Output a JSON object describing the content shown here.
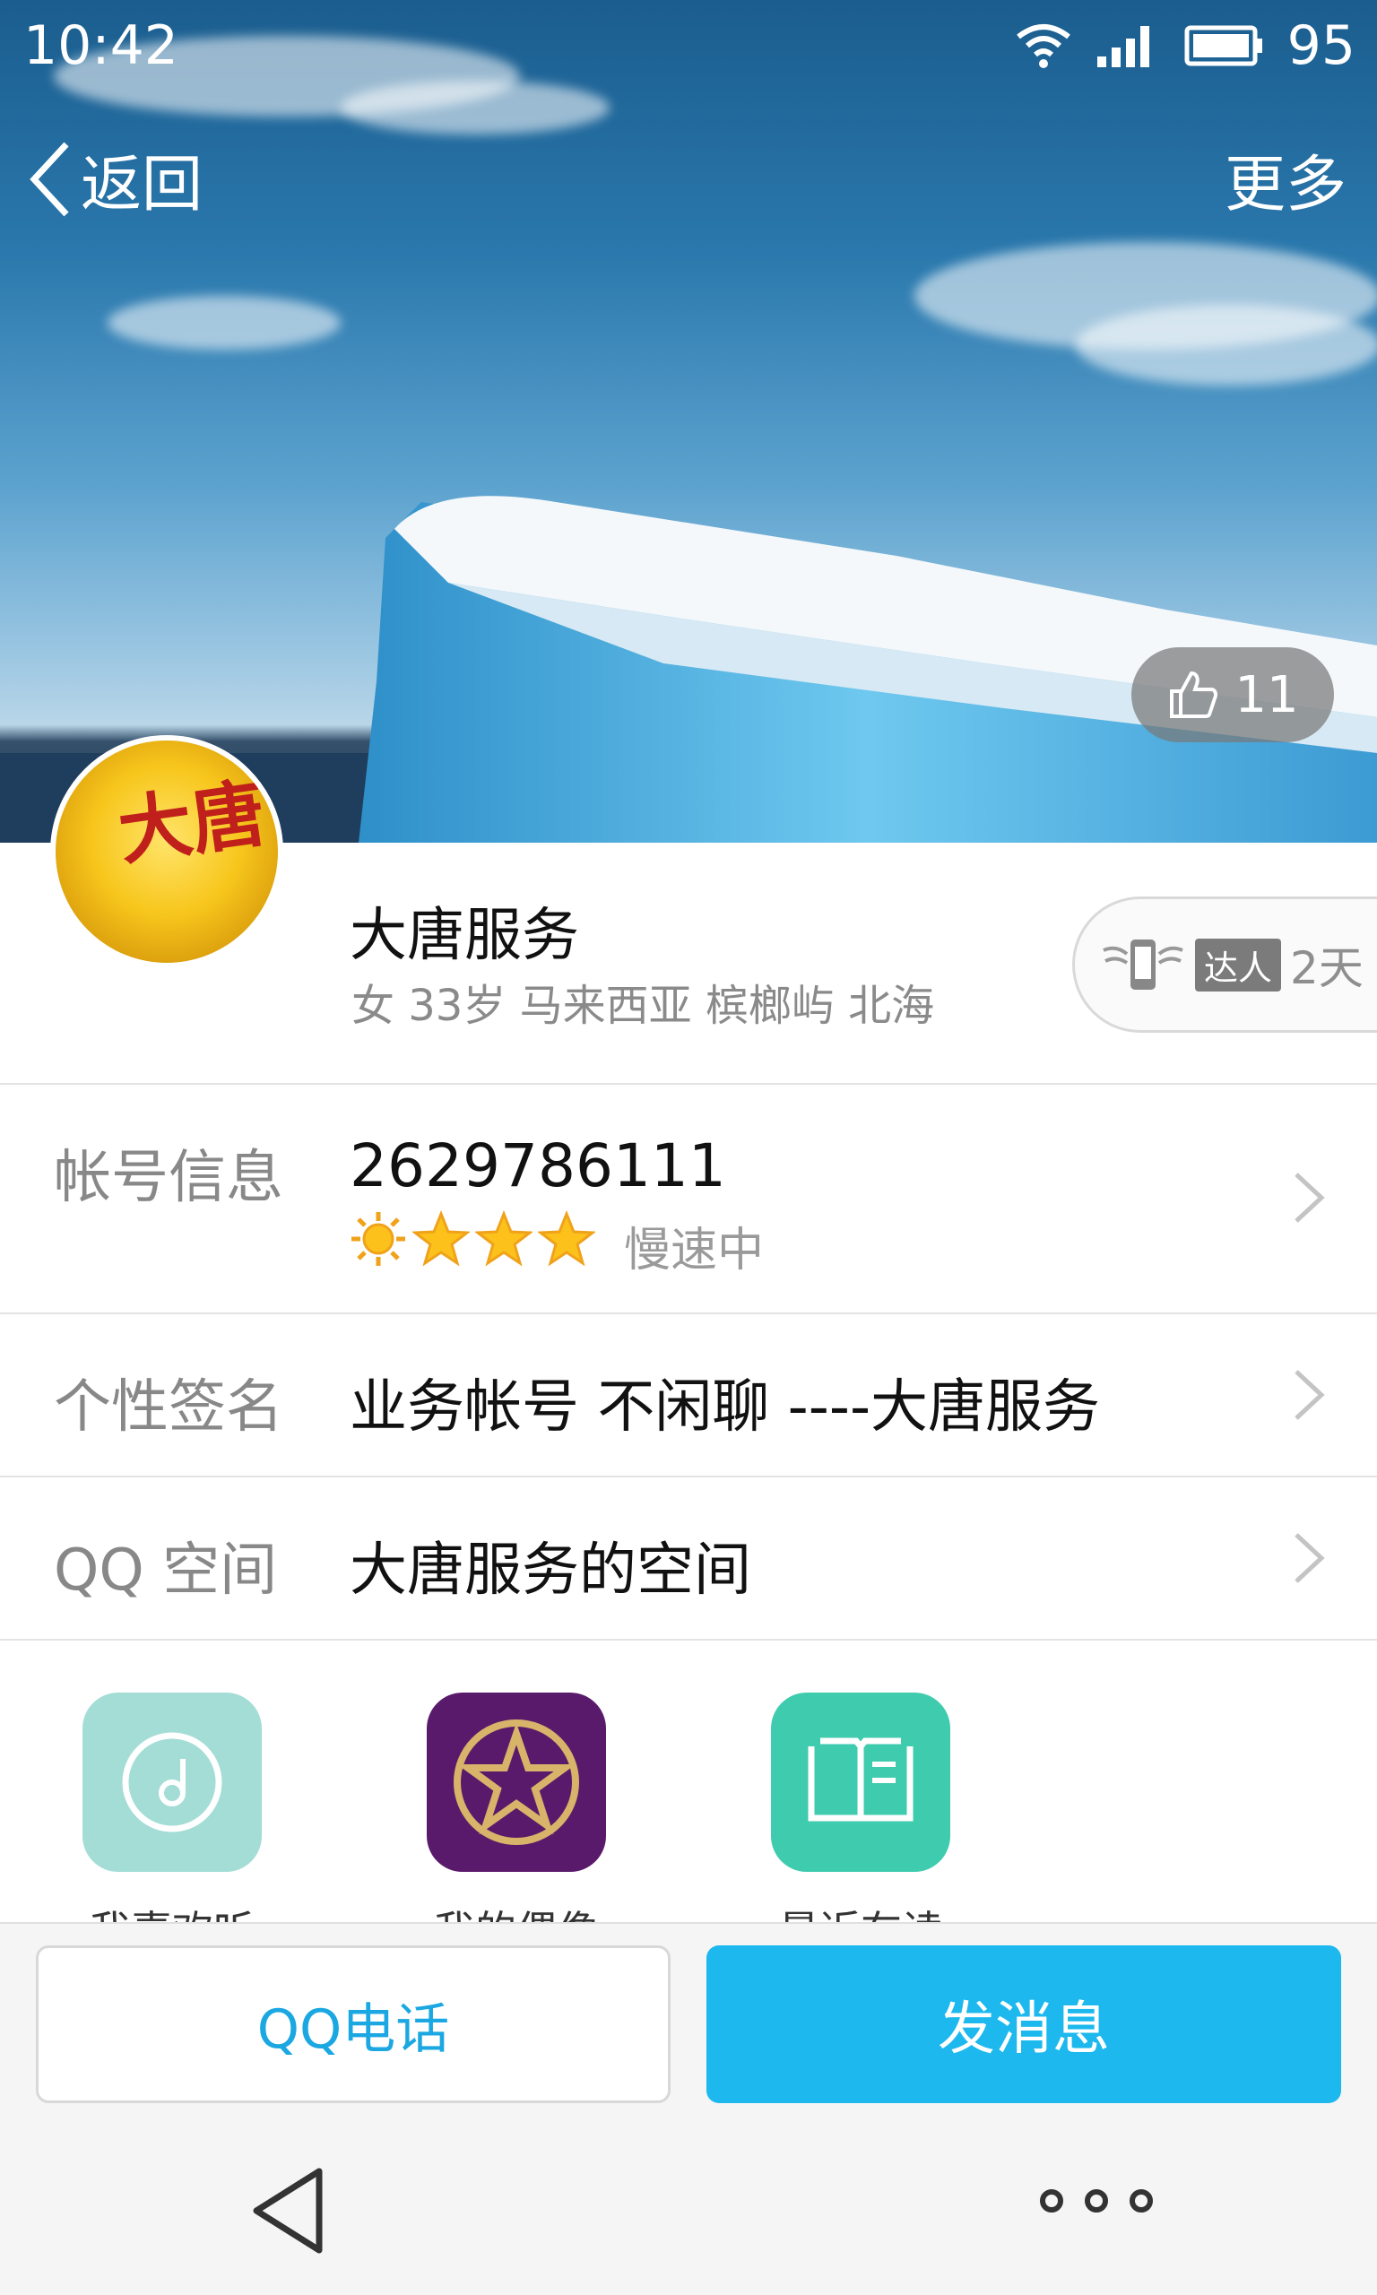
{
  "status_bar": {
    "time": "10:42",
    "battery": "95"
  },
  "nav": {
    "back_label": "返回",
    "more_label": "更多"
  },
  "likes": {
    "count": "11"
  },
  "avatar": {
    "logo_text": "大唐"
  },
  "profile": {
    "name": "大唐服务",
    "meta": "女 33岁 马来西亚 槟榔屿 北海",
    "talent_tag": "达人",
    "talent_days": "2天"
  },
  "account": {
    "label": "帐号信息",
    "number": "2629786111",
    "level_icons": [
      "sun-icon",
      "star-icon",
      "star-icon",
      "star-icon"
    ],
    "speed": "慢速中"
  },
  "signature": {
    "label": "个性签名",
    "value": "业务帐号 不闲聊  ----大唐服务"
  },
  "qzone": {
    "label": "QQ 空间",
    "value": "大唐服务的空间"
  },
  "apps": [
    {
      "label": "我喜欢听",
      "icon": "music-disc-icon",
      "color": "#a3ddd6"
    },
    {
      "label": "我的偶像",
      "icon": "star-circle-icon",
      "color": "#5a1a6b"
    },
    {
      "label": "最近在读",
      "icon": "book-icon",
      "color": "#3fcbae"
    }
  ],
  "actions": {
    "call_label": "QQ电话",
    "message_label": "发消息"
  }
}
